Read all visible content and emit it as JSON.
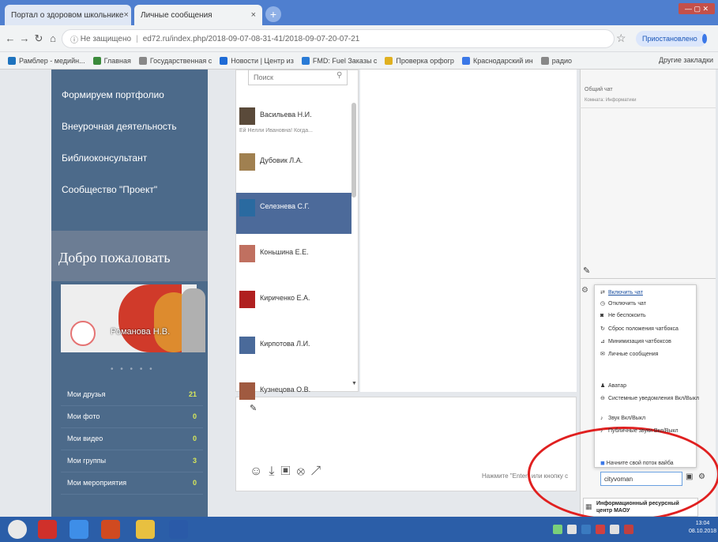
{
  "browser": {
    "tabs": [
      {
        "label": "Портал о здоровом школьнике"
      },
      {
        "label": "Личные сообщения"
      }
    ],
    "url_prefix": "Не защищено",
    "url": "ed72.ru/index.php/2018-09-07-08-31-41/2018-09-07-20-07-21",
    "profile_label": "Приостановлено"
  },
  "bookmarks": [
    {
      "label": "Рамблер - медийн...",
      "color": "#1e73be"
    },
    {
      "label": "Главная",
      "color": "#3b8a3b"
    },
    {
      "label": "Государственная с",
      "color": "#888888"
    },
    {
      "label": "Новости | Центр из",
      "color": "#1e6bd6"
    },
    {
      "label": "FMD: Fuel Заказы с",
      "color": "#2a7bd6"
    },
    {
      "label": "Проверка орфогр",
      "color": "#e0b020"
    },
    {
      "label": "Краснодарский ин",
      "color": "#3b78e7"
    },
    {
      "label": "радио",
      "color": "#888888"
    }
  ],
  "bookmarks_other": "Другие закладки",
  "leftnav": {
    "items": [
      "Формируем портфолио",
      "Внеурочная деятельность",
      "Библиоконсультант",
      "Сообщество \"Проект\""
    ],
    "welcome": "Добро пожаловать",
    "user_name": "Романова Н.В.",
    "stats": [
      {
        "label": "Мои друзья",
        "count": "21"
      },
      {
        "label": "Мои фото",
        "count": "0"
      },
      {
        "label": "Мои видео",
        "count": "0"
      },
      {
        "label": "Мои группы",
        "count": "3"
      },
      {
        "label": "Мои мероприятия",
        "count": "0"
      }
    ]
  },
  "contacts": {
    "search_placeholder": "Поиск",
    "items": [
      {
        "name": "Васильева Н.И.",
        "sub": "Ей Нелли Ивановна! Когда...",
        "color": "#5a4a3a",
        "selected": false
      },
      {
        "name": "Дубовик Л.А.",
        "sub": "",
        "color": "#a08050",
        "selected": false
      },
      {
        "name": "Селезнева С.Г.",
        "sub": "",
        "color": "#2a6aa0",
        "selected": true
      },
      {
        "name": "Коньшина Е.Е.",
        "sub": "",
        "color": "#c07060",
        "selected": false
      },
      {
        "name": "Кириченко Е.А.",
        "sub": "",
        "color": "#b02020",
        "selected": false
      },
      {
        "name": "Кирпотова Л.И.",
        "sub": "",
        "color": "#4a6a9a",
        "selected": false
      },
      {
        "name": "Кузнецова О.В.",
        "sub": "",
        "color": "#a05a40",
        "selected": false
      }
    ]
  },
  "compose": {
    "hint": "Нажмите \"Enter\" или кнопку с"
  },
  "chat": {
    "title": "Общий чат",
    "subtitle": "Комната: Информатики",
    "menu": [
      {
        "icon": "⇄",
        "label": "Включить чат",
        "link": true
      },
      {
        "icon": "◷",
        "label": "Отключить чат",
        "link": false
      },
      {
        "icon": "◙",
        "label": "Не беспокоить",
        "link": false
      },
      {
        "icon": "↻",
        "label": "Сброс положения чатбокса",
        "link": false
      },
      {
        "icon": "⊿",
        "label": "Минимизация чатбоксов",
        "link": false
      },
      {
        "icon": "✉",
        "label": "Личные сообщения",
        "link": false
      },
      {
        "icon": "♟",
        "label": "Аватар",
        "link": false
      },
      {
        "icon": "⊖",
        "label": "Системные уведомления Вкл/Выкл",
        "link": false
      },
      {
        "icon": "♪",
        "label": "Звук Вкл/Выкл",
        "link": false
      },
      {
        "icon": "♪",
        "label": "Публичные звуки Вкл/Выкл",
        "link": false
      }
    ],
    "start_label": "Начните свой поток вайба",
    "input_value": "cityvoman",
    "info_center": "Информационный ресурсный центр МАОУ"
  },
  "taskbar": {
    "clock_time": "13:04",
    "clock_date": "08.10.2018",
    "apps": [
      {
        "name": "start",
        "color": "#e8e8e8"
      },
      {
        "name": "yandex",
        "color": "#d0302a"
      },
      {
        "name": "chrome",
        "color": "#3e8ee8"
      },
      {
        "name": "powerpoint",
        "color": "#d04a20"
      },
      {
        "name": "explorer",
        "color": "#e8c040"
      },
      {
        "name": "word",
        "color": "#2a5aa8"
      }
    ]
  }
}
